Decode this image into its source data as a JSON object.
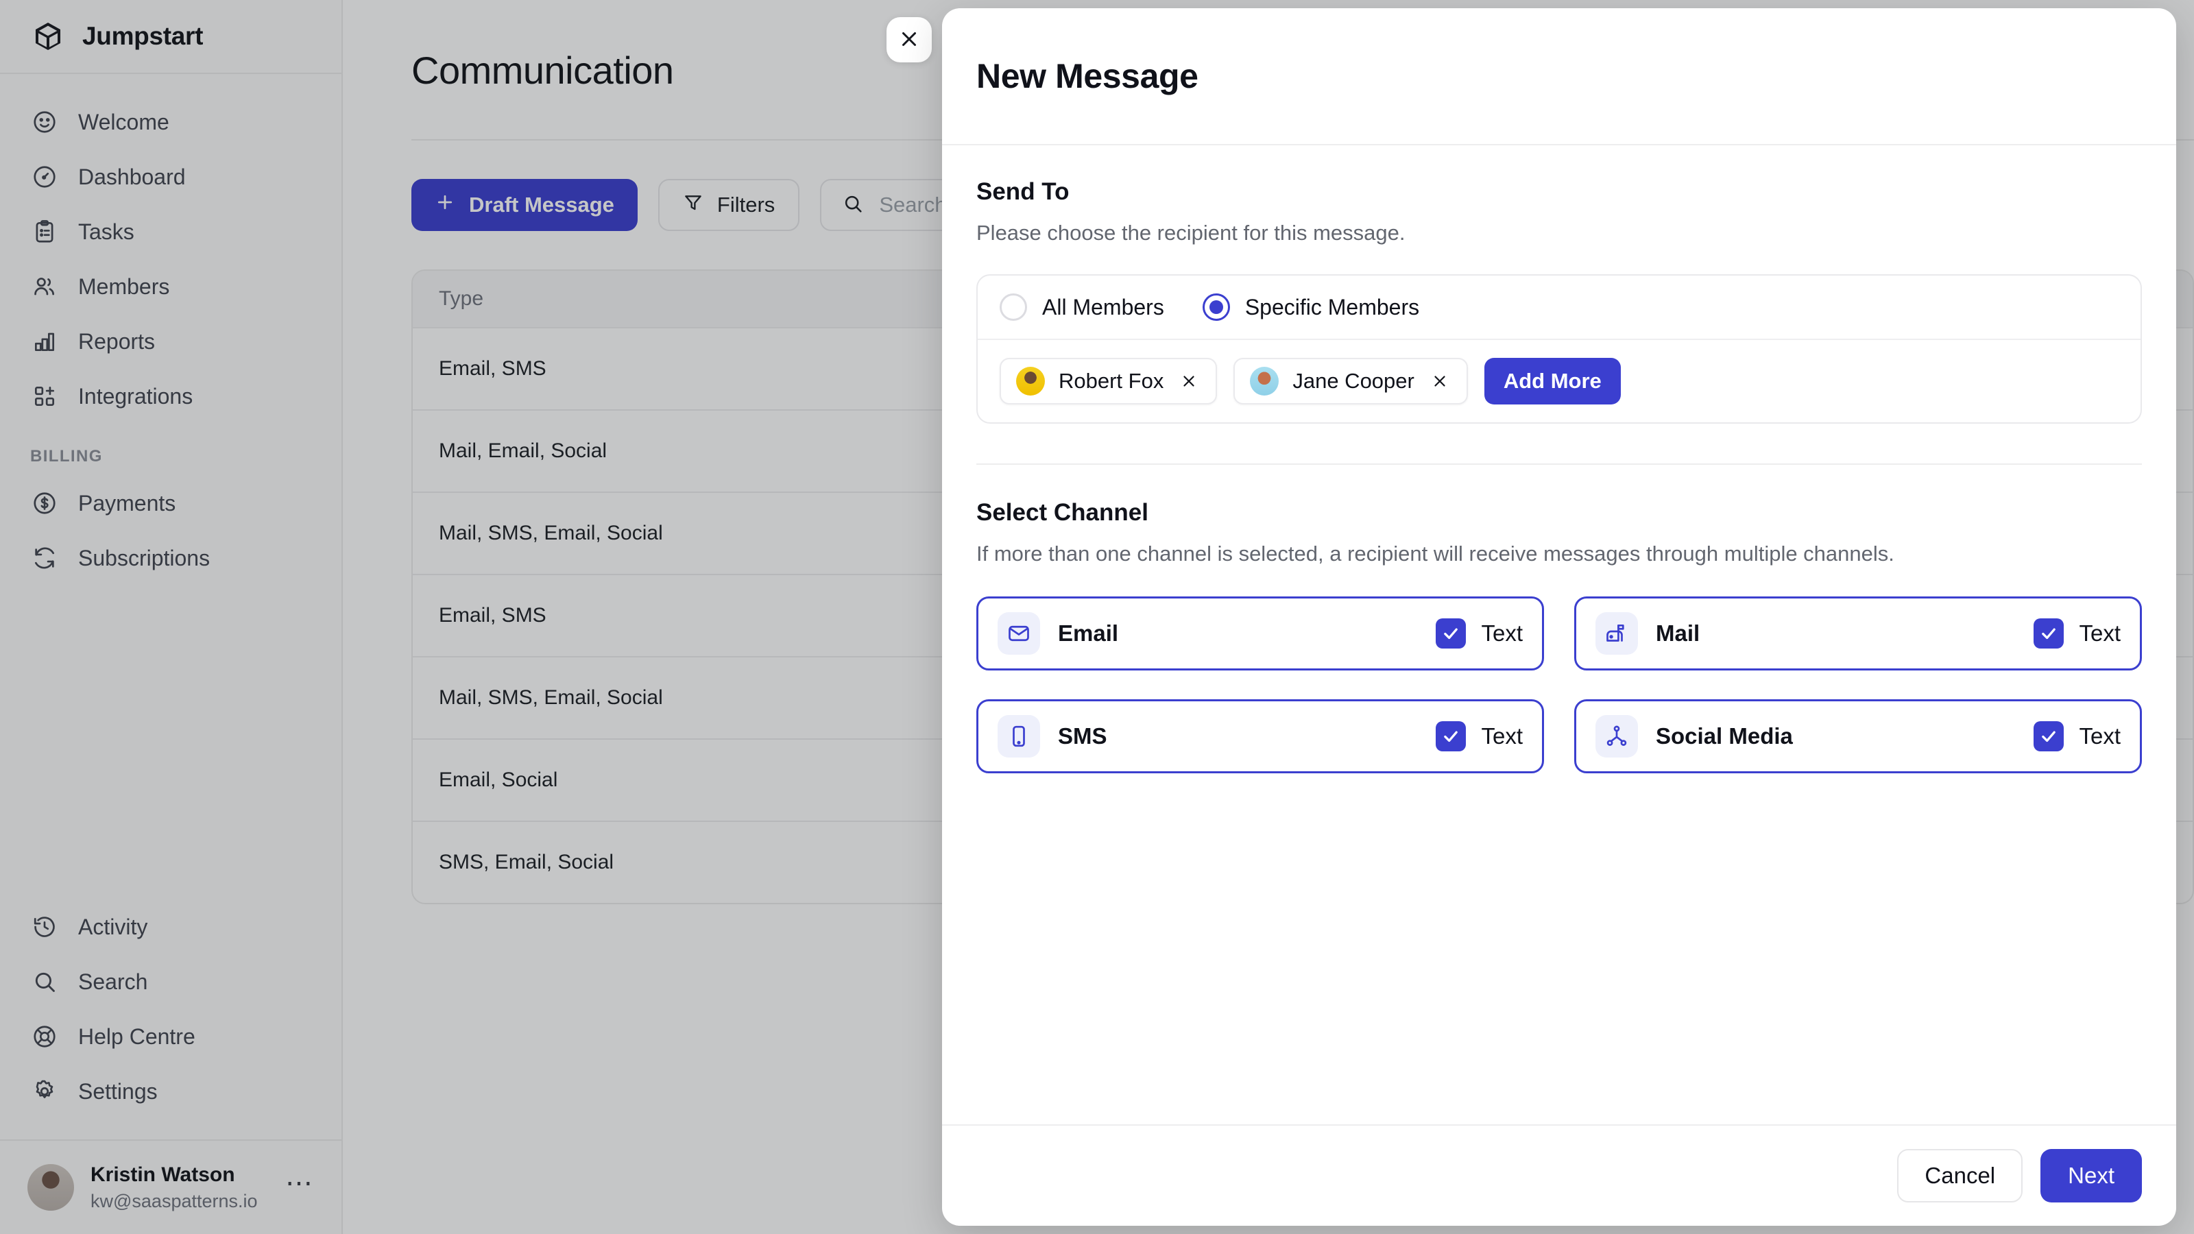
{
  "app": {
    "brand": "Jumpstart",
    "logo_icon": "cube-icon"
  },
  "sidebar": {
    "items": [
      {
        "label": "Welcome",
        "icon": "smiley-icon"
      },
      {
        "label": "Dashboard",
        "icon": "gauge-icon"
      },
      {
        "label": "Tasks",
        "icon": "clipboard-icon"
      },
      {
        "label": "Members",
        "icon": "users-icon"
      },
      {
        "label": "Reports",
        "icon": "bar-chart-icon"
      },
      {
        "label": "Integrations",
        "icon": "grid-plus-icon"
      }
    ],
    "section_label": "BILLING",
    "billing_items": [
      {
        "label": "Payments",
        "icon": "dollar-circle-icon"
      },
      {
        "label": "Subscriptions",
        "icon": "refresh-icon"
      }
    ],
    "bottom_items": [
      {
        "label": "Activity",
        "icon": "history-icon"
      },
      {
        "label": "Search",
        "icon": "search-icon"
      },
      {
        "label": "Help Centre",
        "icon": "lifebuoy-icon"
      },
      {
        "label": "Settings",
        "icon": "gear-icon"
      }
    ],
    "user": {
      "name": "Kristin Watson",
      "email": "kw@saaspatterns.io",
      "menu_icon": "ellipsis-icon"
    }
  },
  "main": {
    "page_title": "Communication",
    "toolbar": {
      "draft_label": "Draft Message",
      "draft_icon": "plus-icon",
      "filters_label": "Filters",
      "filters_icon": "funnel-icon",
      "search_placeholder": "Search",
      "search_icon": "search-icon",
      "search_value": ""
    },
    "table": {
      "columns": [
        "Type"
      ],
      "rows": [
        "Email, SMS",
        "Mail, Email, Social",
        "Mail, SMS, Email, Social",
        "Email, SMS",
        "Mail, SMS, Email, Social",
        "Email, Social",
        "SMS, Email, Social"
      ]
    }
  },
  "modal": {
    "title": "New Message",
    "close_icon": "close-icon",
    "send_to": {
      "heading": "Send To",
      "description": "Please choose the recipient for this message.",
      "options": [
        {
          "label": "All Members",
          "selected": false
        },
        {
          "label": "Specific Members",
          "selected": true
        }
      ],
      "recipients": [
        {
          "name": "Robert Fox",
          "remove_icon": "close-icon",
          "avatar": "avatar-robert-fox"
        },
        {
          "name": "Jane Cooper",
          "remove_icon": "close-icon",
          "avatar": "avatar-jane-cooper"
        }
      ],
      "add_more_label": "Add More"
    },
    "select_channel": {
      "heading": "Select Channel",
      "description": "If more than one channel is selected, a recipient will receive messages through multiple channels.",
      "channels": [
        {
          "name": "Email",
          "icon": "envelope-icon",
          "toggle_label": "Text",
          "checked": true
        },
        {
          "name": "Mail",
          "icon": "mailbox-icon",
          "toggle_label": "Text",
          "checked": true
        },
        {
          "name": "SMS",
          "icon": "phone-icon",
          "toggle_label": "Text",
          "checked": true
        },
        {
          "name": "Social Media",
          "icon": "share-nodes-icon",
          "toggle_label": "Text",
          "checked": true
        }
      ]
    },
    "footer": {
      "cancel_label": "Cancel",
      "next_label": "Next"
    }
  },
  "colors": {
    "accent": "#3B3FCF",
    "text": "#10121A",
    "muted": "#62666F",
    "border": "#EDEDEE"
  }
}
